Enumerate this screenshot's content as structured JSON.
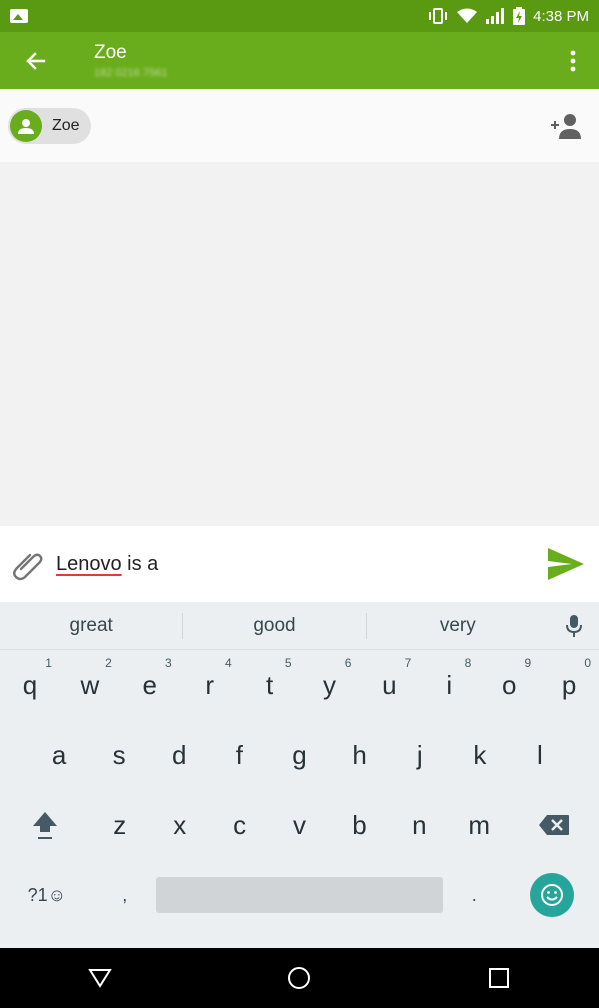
{
  "status_bar": {
    "time": "4:38 PM",
    "icons": [
      "image-notification-icon",
      "vibrate-icon",
      "wifi-icon",
      "signal-icon",
      "battery-charging-icon"
    ]
  },
  "app_bar": {
    "title": "Zoe",
    "subtitle": "182 0216 7561",
    "back_icon": "back-arrow-icon",
    "menu_icon": "overflow-menu-icon",
    "color": "#6aad1c",
    "status_color": "#5a9a12"
  },
  "recipients": {
    "chips": [
      {
        "label": "Zoe",
        "avatar_icon": "person-icon"
      }
    ],
    "add_icon": "add-contact-icon"
  },
  "compose": {
    "text_misspelled": "Lenovo",
    "text_rest": " is a",
    "attach_icon": "paperclip-icon",
    "send_icon": "send-icon",
    "send_color": "#6aad1c"
  },
  "keyboard": {
    "suggestions": [
      "great",
      "good",
      "very"
    ],
    "row1": [
      {
        "key": "q",
        "hint": "1"
      },
      {
        "key": "w",
        "hint": "2"
      },
      {
        "key": "e",
        "hint": "3"
      },
      {
        "key": "r",
        "hint": "4"
      },
      {
        "key": "t",
        "hint": "5"
      },
      {
        "key": "y",
        "hint": "6"
      },
      {
        "key": "u",
        "hint": "7"
      },
      {
        "key": "i",
        "hint": "8"
      },
      {
        "key": "o",
        "hint": "9"
      },
      {
        "key": "p",
        "hint": "0"
      }
    ],
    "row2": [
      "a",
      "s",
      "d",
      "f",
      "g",
      "h",
      "j",
      "k",
      "l"
    ],
    "row3": [
      "z",
      "x",
      "c",
      "v",
      "b",
      "n",
      "m"
    ],
    "symbols_label": "?1☺",
    "comma": ",",
    "period": "."
  },
  "nav_bar": {
    "icons": [
      "back-triangle-icon",
      "home-circle-icon",
      "recents-square-icon"
    ]
  }
}
